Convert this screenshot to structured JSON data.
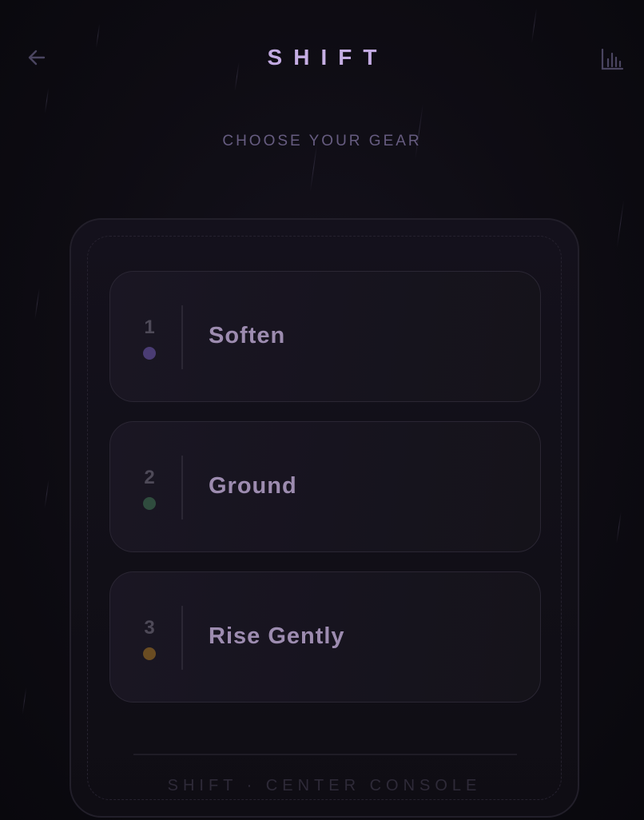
{
  "header": {
    "title": "SHIFT",
    "back_icon": "arrow-left-icon",
    "stats_icon": "bar-chart-icon"
  },
  "subtitle": "CHOOSE YOUR GEAR",
  "gears": [
    {
      "number": "1",
      "label": "Soften",
      "dot_color": "#4a3c74"
    },
    {
      "number": "2",
      "label": "Ground",
      "dot_color": "#2f4c3e"
    },
    {
      "number": "3",
      "label": "Rise Gently",
      "dot_color": "#6a4c22"
    }
  ],
  "console_footer": "SHIFT · CENTER CONSOLE",
  "colors": {
    "background": "#0d0b12",
    "accent": "#b79ad8",
    "label": "#9d8cb0"
  }
}
